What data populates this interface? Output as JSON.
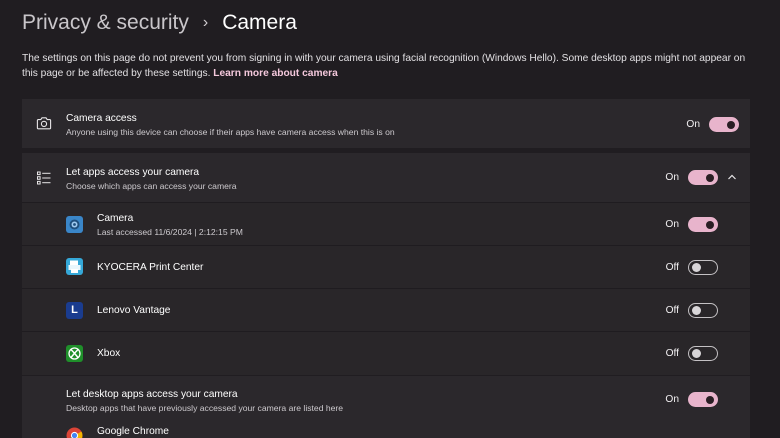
{
  "breadcrumb": {
    "parent": "Privacy & security",
    "separator": "›",
    "current": "Camera"
  },
  "intro": {
    "text": "The settings on this page do not prevent you from signing in with your camera using facial recognition (Windows Hello). Some desktop apps might not appear on this page or be affected by these settings.",
    "link": "Learn more about camera"
  },
  "camera_access": {
    "title": "Camera access",
    "description": "Anyone using this device can choose if their apps have camera access when this is on",
    "state": "On",
    "enabled": true,
    "icon": "camera-icon"
  },
  "apps_access": {
    "title": "Let apps access your camera",
    "description": "Choose which apps can access your camera",
    "state": "On",
    "enabled": true,
    "icon": "list-icon",
    "expand_icon": "chevron-up-icon",
    "apps": [
      {
        "name": "Camera",
        "detail": "Last accessed 11/6/2024  |  2:12:15 PM",
        "state": "On",
        "enabled": true,
        "icon": "camera-app-icon"
      },
      {
        "name": "KYOCERA Print Center",
        "detail": "",
        "state": "Off",
        "enabled": false,
        "icon": "kyocera-app-icon"
      },
      {
        "name": "Lenovo Vantage",
        "detail": "",
        "state": "Off",
        "enabled": false,
        "icon": "lenovo-vantage-app-icon"
      },
      {
        "name": "Xbox",
        "detail": "",
        "state": "Off",
        "enabled": false,
        "icon": "xbox-app-icon"
      }
    ]
  },
  "desktop_access": {
    "title": "Let desktop apps access your camera",
    "description": "Desktop apps that have previously accessed your camera are listed here",
    "state": "On",
    "enabled": true,
    "apps": [
      {
        "name": "Google Chrome",
        "icon": "chrome-app-icon"
      }
    ]
  },
  "colors": {
    "accent": "#e8b4cc",
    "link": "#f4c8dc",
    "background": "#201d21",
    "card": "#2b282c"
  },
  "lenovo_letter": "L"
}
